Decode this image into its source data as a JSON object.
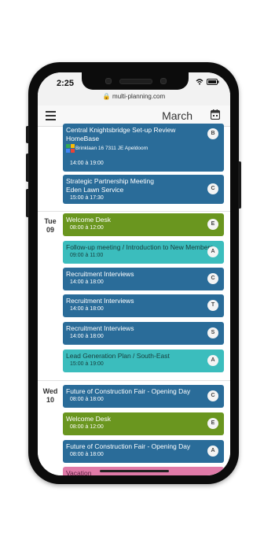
{
  "status": {
    "time": "2:25"
  },
  "browser": {
    "url": "multi-planning.com"
  },
  "header": {
    "month": "March"
  },
  "colors": {
    "blue": "#2a6c99",
    "green": "#6a961f",
    "teal": "#3bbdbd",
    "pink": "#e07aa8"
  },
  "days": [
    {
      "weekday": "Tue",
      "date": "09"
    },
    {
      "weekday": "Wed",
      "date": "10"
    }
  ],
  "events": [
    {
      "title": "Central Knightsbridge Set-up Review",
      "subtitle": "HomeBase",
      "location": "Brinklaan 16 7311 JE Apeldoorn",
      "time": "14:00 à 19:00",
      "badge": "B"
    },
    {
      "title": "Strategic Partnership Meeting",
      "subtitle": "Eden Lawn Service",
      "time": "15:00 à 17:30",
      "badge": "C"
    },
    {
      "title": "Welcome Desk",
      "time": "08:00 à 12:00",
      "badge": "E"
    },
    {
      "title": "Follow-up meeting / Introduction to New Members",
      "time": "09:00 à 11:00",
      "badge": "A"
    },
    {
      "title": "Recruitment Interviews",
      "time": "14:00 à 18:00",
      "badge": "C"
    },
    {
      "title": "Recruitment Interviews",
      "time": "14:00 à 18:00",
      "badge": "T"
    },
    {
      "title": "Recruitment Interviews",
      "time": "14:00 à 18:00",
      "badge": "S"
    },
    {
      "title": "Lead Generation Plan / South-East",
      "time": "15:00 à 19:00",
      "badge": "A"
    },
    {
      "title": "Future of Construction Fair - Opening Day",
      "time": "08:00 à 18:00",
      "badge": "C"
    },
    {
      "title": "Welcome Desk",
      "time": "08:00 à 12:00",
      "badge": "E"
    },
    {
      "title": "Future of Construction Fair - Opening Day",
      "time": "08:00 à 18:00",
      "badge": "A"
    },
    {
      "title": "Vacation"
    }
  ]
}
